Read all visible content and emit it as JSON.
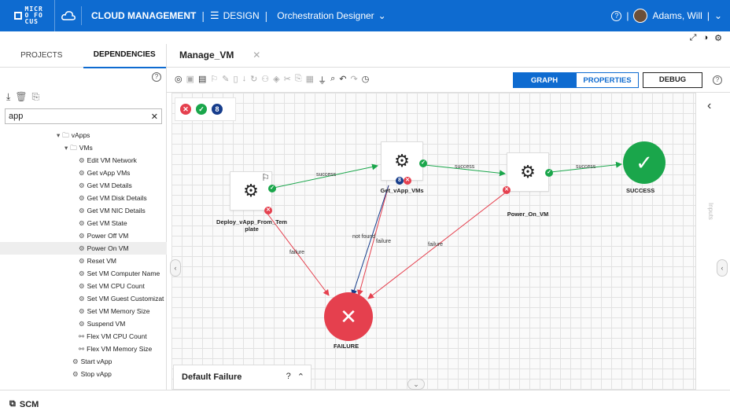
{
  "header": {
    "logo_text": "MICRO FOCUS",
    "app_title": "CLOUD MANAGEMENT",
    "section": "DESIGN",
    "page": "Orchestration Designer",
    "user": "Adams, Will"
  },
  "left_panel": {
    "tabs": [
      "PROJECTS",
      "DEPENDENCIES"
    ],
    "active_tab": "DEPENDENCIES",
    "search_value": "app",
    "tree": [
      {
        "label": "vApps",
        "icon": "folder-icon",
        "expander": "▾"
      },
      {
        "label": "VMs",
        "icon": "folder-icon",
        "expander": "▾"
      },
      {
        "label": "Edit VM Network",
        "icon": "gear-icon"
      },
      {
        "label": "Get vApp VMs",
        "icon": "gear-icon"
      },
      {
        "label": "Get VM Details",
        "icon": "gear-icon"
      },
      {
        "label": "Get VM Disk Details",
        "icon": "gear-icon"
      },
      {
        "label": "Get VM NIC Details",
        "icon": "gear-icon"
      },
      {
        "label": "Get VM State",
        "icon": "gear-icon"
      },
      {
        "label": "Power Off VM",
        "icon": "gear-icon"
      },
      {
        "label": "Power On VM",
        "icon": "gear-icon"
      },
      {
        "label": "Reset VM",
        "icon": "gear-icon"
      },
      {
        "label": "Set VM Computer Name",
        "icon": "gear-icon"
      },
      {
        "label": "Set VM CPU Count",
        "icon": "gear-icon"
      },
      {
        "label": "Set VM Guest Customizat",
        "icon": "gear-icon"
      },
      {
        "label": "Set VM Memory Size",
        "icon": "gear-icon"
      },
      {
        "label": "Suspend VM",
        "icon": "gear-icon"
      },
      {
        "label": "Flex VM CPU Count",
        "icon": "flow-icon"
      },
      {
        "label": "Flex VM Memory Size",
        "icon": "flow-icon"
      },
      {
        "label": "Start vApp",
        "icon": "gear-icon"
      },
      {
        "label": "Stop vApp",
        "icon": "gear-icon"
      }
    ],
    "selected_item": "Power On VM"
  },
  "editor": {
    "tab_title": "Manage_VM",
    "view_buttons": [
      "GRAPH",
      "PROPERTIES"
    ],
    "active_view": "GRAPH",
    "debug_label": "DEBUG",
    "right_panel_label": "Inputs",
    "default_failure_label": "Default Failure"
  },
  "flow": {
    "steps": [
      {
        "id": "deploy",
        "label": "Deploy_vApp_From_Tem plate"
      },
      {
        "id": "get",
        "label": "Get_vApp_VMs"
      },
      {
        "id": "power",
        "label": "Power_On_VM"
      }
    ],
    "success_label": "SUCCESS",
    "failure_label": "FAILURE",
    "edge_labels": {
      "success": "success",
      "failure": "failure",
      "not_found": "not found"
    }
  },
  "bottom": {
    "scm_label": "SCM"
  },
  "colors": {
    "brand_blue": "#0e6bd0",
    "success_green": "#1aa64b",
    "failure_red": "#e5404e",
    "navy": "#163d8c"
  }
}
